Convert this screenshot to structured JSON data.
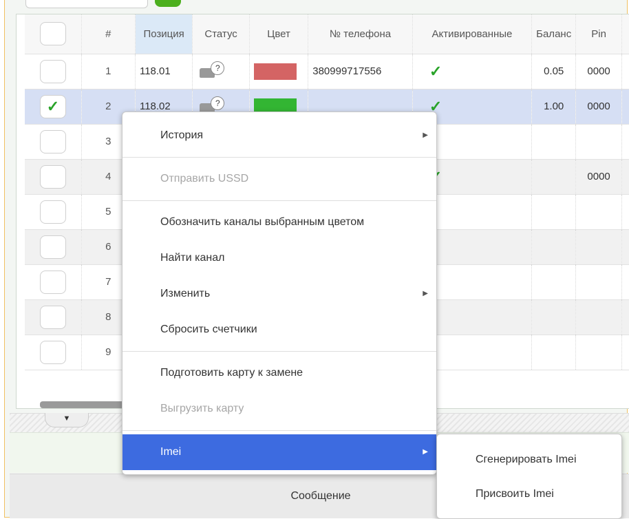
{
  "table": {
    "columns": [
      "#",
      "Позиция",
      "Статус",
      "Цвет",
      "№ телефона",
      "Активированные",
      "Баланс",
      "Pin"
    ],
    "rows": [
      {
        "num": "1",
        "position": "118.01",
        "phone": "380999717556",
        "activated": true,
        "balance": "0.05",
        "pin": "0000",
        "color": "#d46464",
        "selected": false
      },
      {
        "num": "2",
        "position": "118.02",
        "phone": "",
        "activated": true,
        "balance": "1.00",
        "pin": "0000",
        "color": "#33b533",
        "selected": true
      },
      {
        "num": "3",
        "position": "",
        "phone": "",
        "activated": false,
        "balance": "",
        "pin": "",
        "color": "",
        "selected": false
      },
      {
        "num": "4",
        "position": "",
        "phone": "",
        "activated": true,
        "balance": "",
        "pin": "0000",
        "color": "",
        "selected": false
      },
      {
        "num": "5",
        "position": "",
        "phone": "",
        "activated": false,
        "balance": "",
        "pin": "",
        "color": "",
        "selected": false
      },
      {
        "num": "6",
        "position": "",
        "phone": "",
        "activated": false,
        "balance": "",
        "pin": "",
        "color": "",
        "selected": false
      },
      {
        "num": "7",
        "position": "",
        "phone": "",
        "activated": false,
        "balance": "",
        "pin": "",
        "color": "",
        "selected": false
      },
      {
        "num": "8",
        "position": "",
        "phone": "",
        "activated": false,
        "balance": "",
        "pin": "",
        "color": "",
        "selected": false
      },
      {
        "num": "9",
        "position": "",
        "phone": "",
        "activated": false,
        "balance": "",
        "pin": "",
        "color": "",
        "selected": false
      }
    ],
    "status_icon_glyph": "?"
  },
  "context_menu": {
    "items": [
      {
        "label": "История",
        "disabled": false,
        "submenu": true,
        "sep_after": true
      },
      {
        "label": "Отправить USSD",
        "disabled": true,
        "submenu": false,
        "sep_after": true
      },
      {
        "label": "Обозначить каналы выбранным цветом",
        "disabled": false,
        "submenu": false,
        "sep_after": false
      },
      {
        "label": "Найти канал",
        "disabled": false,
        "submenu": false,
        "sep_after": false
      },
      {
        "label": "Изменить",
        "disabled": false,
        "submenu": true,
        "sep_after": false
      },
      {
        "label": "Сбросить счетчики",
        "disabled": false,
        "submenu": false,
        "sep_after": true
      },
      {
        "label": "Подготовить карту к замене",
        "disabled": false,
        "submenu": false,
        "sep_after": false
      },
      {
        "label": "Выгрузить карту",
        "disabled": true,
        "submenu": false,
        "sep_after": true
      },
      {
        "label": "Imei",
        "disabled": false,
        "submenu": true,
        "active": true,
        "sep_after": false
      }
    ],
    "arrow_glyph": "▶"
  },
  "submenu": {
    "items": [
      "Сгенерировать Imei",
      "Присвоить Imei"
    ]
  },
  "toggle_glyph": "▼",
  "check_glyph": "✓",
  "bottom_bar": {
    "label": "Сообщение"
  },
  "colors": {
    "menu_active": "#3d6be0",
    "check_green": "#29a329",
    "selected_row": "#d6dff4",
    "frame_border": "#f0c060"
  }
}
